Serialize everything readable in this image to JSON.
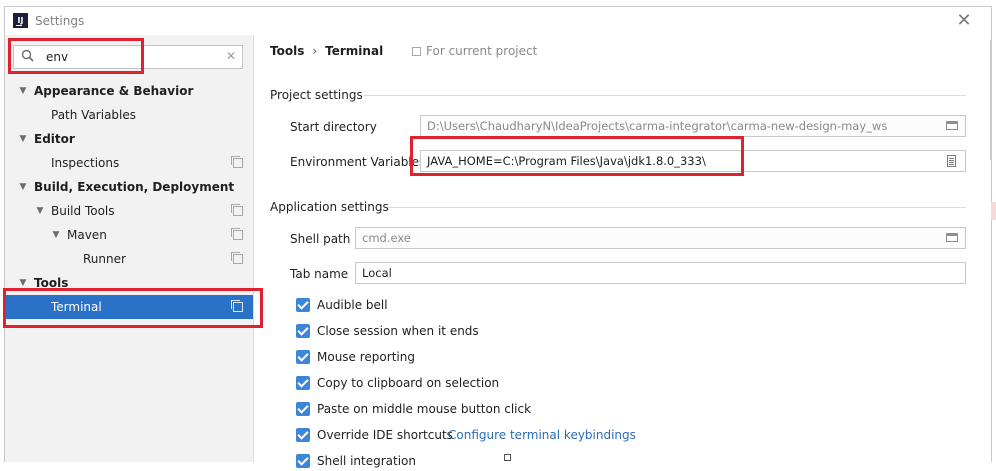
{
  "window": {
    "title": "Settings",
    "close_symbol": "✕"
  },
  "search": {
    "value": "env",
    "clear_symbol": "✕"
  },
  "tree": [
    {
      "label": "Appearance & Behavior",
      "bold": true,
      "arrow": "▼"
    },
    {
      "label": "Path Variables",
      "bold": false
    },
    {
      "label": "Editor",
      "bold": true,
      "arrow": "▼"
    },
    {
      "label": "Inspections",
      "bold": false
    },
    {
      "label": "Build, Execution, Deployment",
      "bold": true,
      "arrow": "▼"
    },
    {
      "label": "Build Tools",
      "bold": false,
      "arrow": "▼"
    },
    {
      "label": "Maven",
      "bold": false,
      "arrow": "▼"
    },
    {
      "label": "Runner",
      "bold": false
    },
    {
      "label": "Tools",
      "bold": true,
      "arrow": "▼"
    },
    {
      "label": "Terminal",
      "bold": false,
      "selected": true
    }
  ],
  "breadcrumb": {
    "first": "Tools",
    "separator": "›",
    "second": "Terminal"
  },
  "scope_label": "For current project",
  "project_settings": {
    "title": "Project settings",
    "start_directory_label": "Start directory",
    "start_directory_value": "D:\\Users\\ChaudharyN\\IdeaProjects\\carma-integrator\\carma-new-design-may_ws",
    "env_vars_label": "Environment Variables",
    "env_vars_value": "JAVA_HOME=C:\\Program Files\\Java\\jdk1.8.0_333\\"
  },
  "application_settings": {
    "title": "Application settings",
    "shell_path_label": "Shell path",
    "shell_path_value": "cmd.exe",
    "tab_name_label": "Tab name",
    "tab_name_value": "Local"
  },
  "checkboxes": [
    {
      "label": "Audible bell",
      "checked": true
    },
    {
      "label": "Close session when it ends",
      "checked": true
    },
    {
      "label": "Mouse reporting",
      "checked": true
    },
    {
      "label": "Copy to clipboard on selection",
      "checked": true
    },
    {
      "label": "Paste on middle mouse button click",
      "checked": true
    },
    {
      "label": "Override IDE shortcuts",
      "checked": true,
      "link": "Configure terminal keybindings"
    },
    {
      "label": "Shell integration",
      "checked": true
    }
  ],
  "colors": {
    "accent": "#2a72c8",
    "checkbox": "#3b86d9",
    "highlight": "#e0212f",
    "link": "#2b6cb5"
  }
}
